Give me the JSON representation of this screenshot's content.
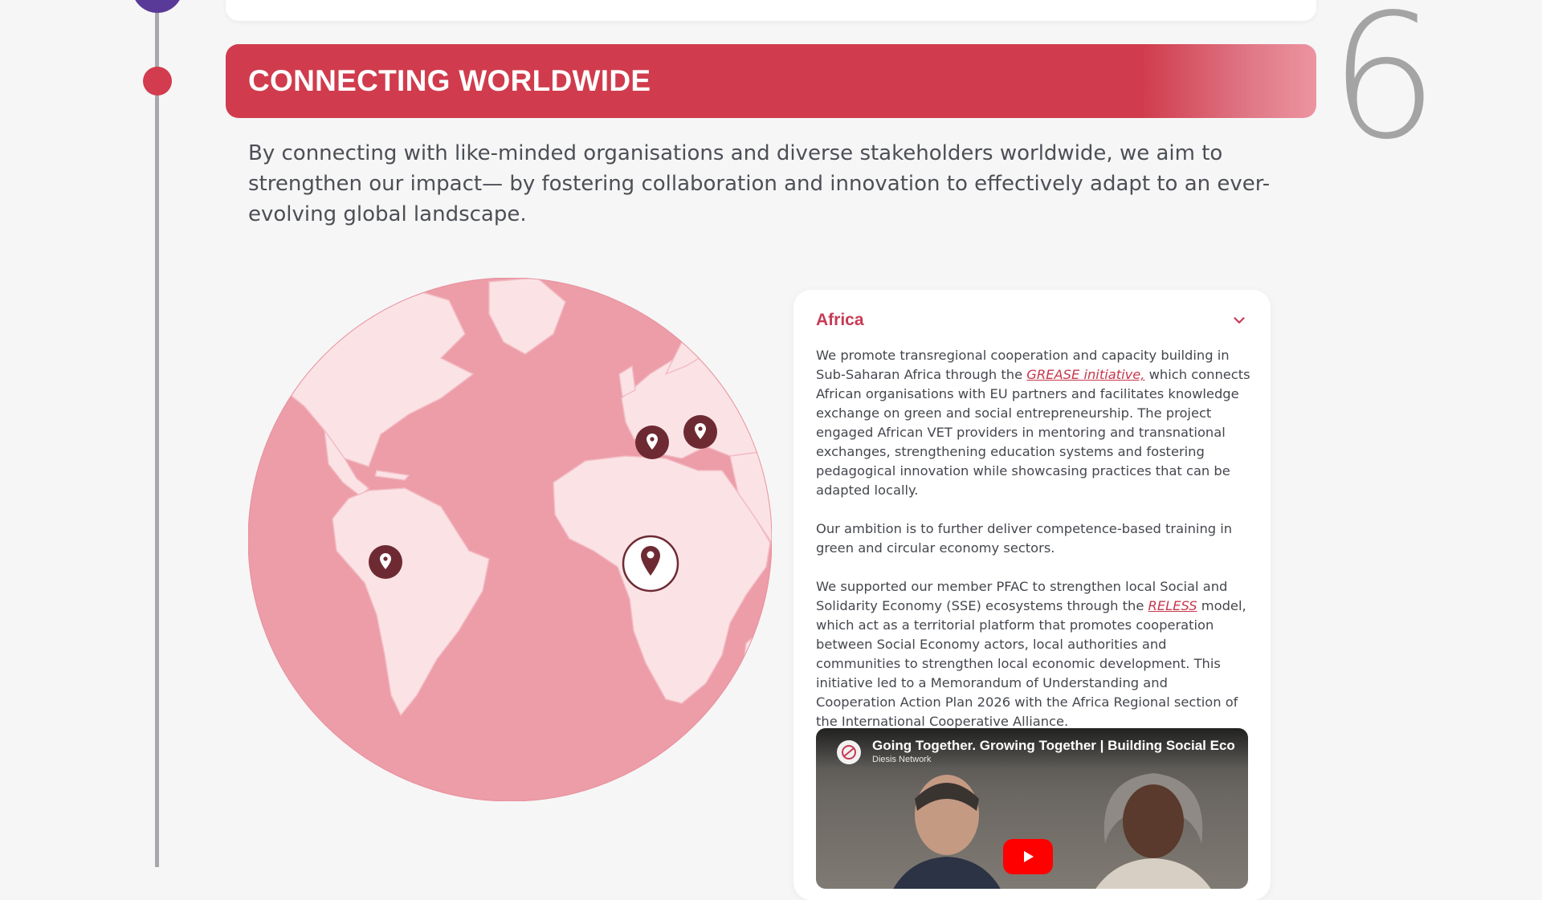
{
  "section": {
    "title": "CONNECTING WORLDWIDE",
    "number": "6",
    "intro": "By connecting with like-minded organisations and diverse stakeholders worldwide, we aim to strengthen our impact— by fostering collaboration and innovation to effectively adapt to an ever-evolving global landscape."
  },
  "map": {
    "pins": [
      "South America",
      "Western Europe",
      "Eastern Europe",
      "Africa"
    ],
    "active_pin": "Africa",
    "colors": {
      "ocean": "#ec9da8",
      "land": "#fbe3e5",
      "pin": "#6e2a33"
    }
  },
  "region": {
    "title": "Africa",
    "p1_before": "We promote transregional cooperation and capacity building in Sub-Saharan Africa through the ",
    "p1_link": "GREASE initiative,",
    "p1_after": " which connects African organisations with EU partners and facilitates knowledge exchange on green and social entrepreneurship. The project engaged African VET providers in mentoring and transnational exchanges, strengthening education systems and fostering pedagogical innovation while showcasing practices that can be adapted locally.",
    "p2": "Our ambition is to further deliver competence-based training in green and circular economy sectors.",
    "p3_before": "We supported our member PFAC to strengthen local Social and Solidarity Economy (SSE) ecosystems through the ",
    "p3_link": "RELESS",
    "p3_after": " model, which act as a territorial platform that promotes cooperation between Social Economy actors, local authorities and communities to strengthen local economic development. This initiative led to a Memorandum of Understanding and Cooperation Action Plan 2026 with the Africa Regional section of the International Cooperative Alliance."
  },
  "video": {
    "title": "Going Together. Growing Together | Building Social Eco",
    "channel": "Diesis Network"
  },
  "colors": {
    "accent": "#d03c4d",
    "timeline_active": "#d23c4e",
    "timeline_prev": "#5a3a98"
  }
}
